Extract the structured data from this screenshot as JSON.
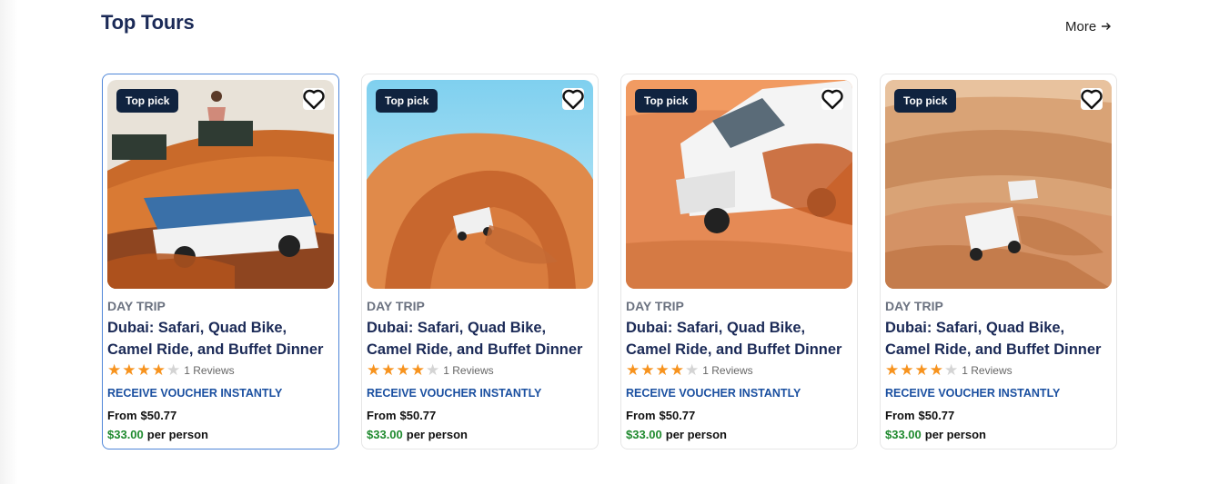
{
  "section": {
    "title": "Top Tours",
    "more_label": "More",
    "more_icon": "arrow-right-icon"
  },
  "cards": [
    {
      "badge": "Top pick",
      "category": "DAY TRIP",
      "title": "Dubai: Safari, Quad Bike, Camel Ride, and Buffet Dinner",
      "rating": 4,
      "reviews": "1 Reviews",
      "voucher": "RECEIVE VOUCHER INSTANTLY",
      "from_label": "From",
      "from_price": "$50.77",
      "sale_price": "$33.00",
      "per_label": "per person"
    },
    {
      "badge": "Top pick",
      "category": "DAY TRIP",
      "title": "Dubai: Safari, Quad Bike, Camel Ride, and Buffet Dinner",
      "rating": 4,
      "reviews": "1 Reviews",
      "voucher": "RECEIVE VOUCHER INSTANTLY",
      "from_label": "From",
      "from_price": "$50.77",
      "sale_price": "$33.00",
      "per_label": "per person"
    },
    {
      "badge": "Top pick",
      "category": "DAY TRIP",
      "title": "Dubai: Safari, Quad Bike, Camel Ride, and Buffet Dinner",
      "rating": 4,
      "reviews": "1 Reviews",
      "voucher": "RECEIVE VOUCHER INSTANTLY",
      "from_label": "From",
      "from_price": "$50.77",
      "sale_price": "$33.00",
      "per_label": "per person"
    },
    {
      "badge": "Top pick",
      "category": "DAY TRIP",
      "title": "Dubai: Safari, Quad Bike, Camel Ride, and Buffet Dinner",
      "rating": 4,
      "reviews": "1 Reviews",
      "voucher": "RECEIVE VOUCHER INSTANTLY",
      "from_label": "From",
      "from_price": "$50.77",
      "sale_price": "$33.00",
      "per_label": "per person"
    }
  ],
  "colors": {
    "title": "#1b2a57",
    "badge_bg": "#10233f",
    "star": "#f7931e",
    "voucher": "#1a4fa0",
    "sale_price": "#1f8a2e",
    "active_border": "#4f86d8"
  }
}
